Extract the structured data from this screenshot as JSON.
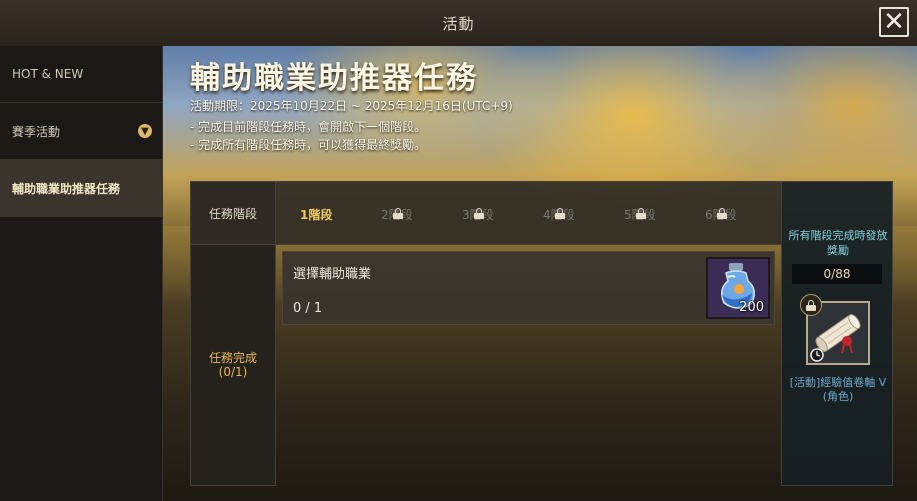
{
  "window": {
    "title": "活動",
    "close_label": "✕"
  },
  "sidebar": {
    "items": [
      {
        "label": "HOT & NEW"
      },
      {
        "label": "賽季活動",
        "expand_icon": "chevron-down-icon"
      },
      {
        "label": "輔助職業助推器任務"
      }
    ]
  },
  "event": {
    "title": "輔助職業助推器任務",
    "period": "活動期限：2025年10月22日 ~ 2025年12月16日(UTC+9)",
    "notes": [
      "- 完成目前階段任務時，會開啟下一個階段。",
      "- 完成所有階段任務時，可以獲得最終獎勵。"
    ]
  },
  "table": {
    "header_label": "任務階段",
    "status_label": "任務完成",
    "status_count": "(0/1)"
  },
  "tabs": [
    {
      "label": "1階段",
      "locked": false
    },
    {
      "label": "2階段",
      "locked": true
    },
    {
      "label": "3階段",
      "locked": true
    },
    {
      "label": "4階段",
      "locked": true
    },
    {
      "label": "5階段",
      "locked": true
    },
    {
      "label": "6階段",
      "locked": true
    }
  ],
  "task": {
    "name": "選擇輔助職業",
    "progress": "0 / 1",
    "reward_qty": "200",
    "reward_icon": "potion-icon"
  },
  "final_reward": {
    "title": "所有階段完成時發放獎勵",
    "count": "0/88",
    "item_icon": "scroll-icon",
    "item_name": "[活動]經驗值卷軸 V (角色)"
  },
  "colors": {
    "accent_gold": "#f1ca60",
    "status_gold": "#e7b94d",
    "final_title": "#7fd2dc",
    "item_name": "#6aa9c9"
  }
}
